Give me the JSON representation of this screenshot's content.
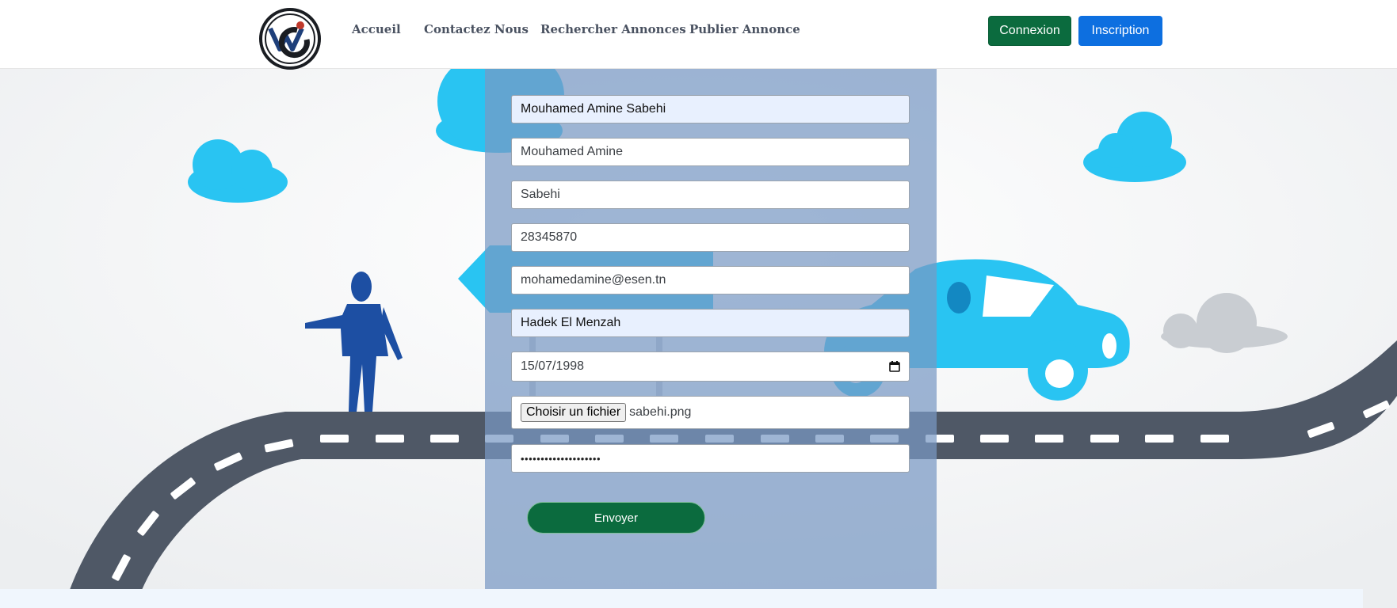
{
  "navbar": {
    "links": [
      "Accueil",
      "Contactez Nous",
      "Rechercher Annonces",
      "Publier Annonce"
    ],
    "login_label": "Connexion",
    "signup_label": "Inscription"
  },
  "form": {
    "fullname": "Mouhamed Amine Sabehi",
    "firstname": "Mouhamed Amine",
    "lastname": "Sabehi",
    "phone": "28345870",
    "email": "mohamedamine@esen.tn",
    "address": "Hadek El Menzah",
    "birthdate": "15/07/1998",
    "file_button_label": "Choisir un fichier",
    "file_name": "sabehi.png",
    "password_mask": "••••••••••••••••••••",
    "submit_label": "Envoyer"
  },
  "colors": {
    "primary_green": "#0b6b3e",
    "primary_blue": "#0d6fe0",
    "panel": "#7898c4",
    "road": "#4f5866",
    "cloud": "#29c4f2",
    "car": "#29c4f2",
    "person": "#1d4fa3"
  },
  "icons": {
    "logo": "wg-logo",
    "calendar": "calendar-icon"
  }
}
